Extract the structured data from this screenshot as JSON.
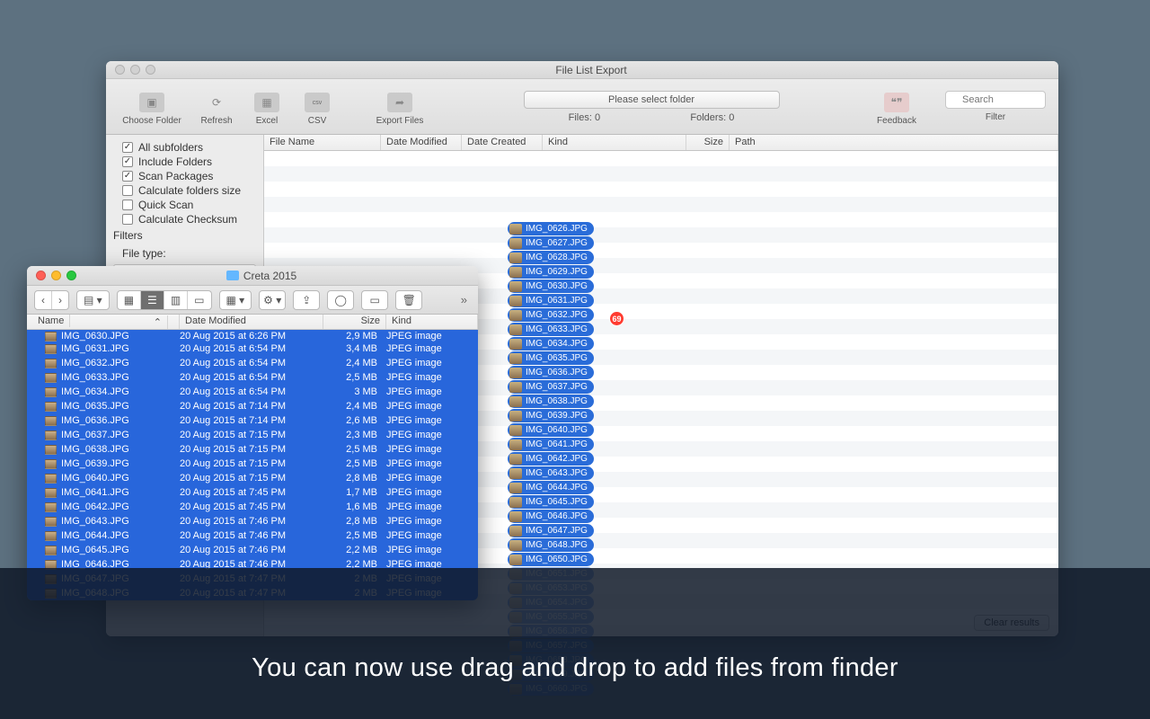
{
  "app": {
    "title": "File List Export",
    "toolbar": {
      "choose_folder": "Choose Folder",
      "refresh": "Refresh",
      "excel": "Excel",
      "csv": "CSV",
      "export_files": "Export Files",
      "feedback": "Feedback",
      "filter": "Filter",
      "search_placeholder": "Search"
    },
    "center": {
      "prompt": "Please select folder",
      "files_label": "Files: 0",
      "folders_label": "Folders: 0"
    },
    "sidebar": {
      "options": [
        {
          "label": "All subfolders",
          "checked": true
        },
        {
          "label": "Include Folders",
          "checked": true
        },
        {
          "label": "Scan Packages",
          "checked": true
        },
        {
          "label": "Calculate folders size",
          "checked": false
        },
        {
          "label": "Quick Scan",
          "checked": false
        },
        {
          "label": "Calculate Checksum",
          "checked": false
        }
      ],
      "filters_label": "Filters",
      "file_type_label": "File type:"
    },
    "columns": [
      "File Name",
      "Date Modified",
      "Date Created",
      "Kind",
      "Size",
      "Path"
    ],
    "clear_results": "Clear results",
    "drop_badge": "69",
    "drop_files": [
      "IMG_0626.JPG",
      "IMG_0627.JPG",
      "IMG_0628.JPG",
      "IMG_0629.JPG",
      "IMG_0630.JPG",
      "IMG_0631.JPG",
      "IMG_0632.JPG",
      "IMG_0633.JPG",
      "IMG_0634.JPG",
      "IMG_0635.JPG",
      "IMG_0636.JPG",
      "IMG_0637.JPG",
      "IMG_0638.JPG",
      "IMG_0639.JPG",
      "IMG_0640.JPG",
      "IMG_0641.JPG",
      "IMG_0642.JPG",
      "IMG_0643.JPG",
      "IMG_0644.JPG",
      "IMG_0645.JPG",
      "IMG_0646.JPG",
      "IMG_0647.JPG",
      "IMG_0648.JPG",
      "IMG_0650.JPG",
      "IMG_0651.JPG",
      "IMG_0653.JPG",
      "IMG_0654.JPG",
      "IMG_0655.JPG",
      "IMG_0656.JPG",
      "IMG_0657.JPG",
      "IMG_0658.JPG",
      "IMG_0659.JPG",
      "IMG_0660.JPG"
    ]
  },
  "finder": {
    "title": "Creta 2015",
    "columns": [
      "Name",
      "Date Modified",
      "Size",
      "Kind"
    ],
    "rows": [
      {
        "name": "IMG_0630.JPG",
        "date": "20 Aug 2015 at 6:26 PM",
        "size": "2,9 MB",
        "kind": "JPEG image"
      },
      {
        "name": "IMG_0631.JPG",
        "date": "20 Aug 2015 at 6:54 PM",
        "size": "3,4 MB",
        "kind": "JPEG image"
      },
      {
        "name": "IMG_0632.JPG",
        "date": "20 Aug 2015 at 6:54 PM",
        "size": "2,4 MB",
        "kind": "JPEG image"
      },
      {
        "name": "IMG_0633.JPG",
        "date": "20 Aug 2015 at 6:54 PM",
        "size": "2,5 MB",
        "kind": "JPEG image"
      },
      {
        "name": "IMG_0634.JPG",
        "date": "20 Aug 2015 at 6:54 PM",
        "size": "3 MB",
        "kind": "JPEG image"
      },
      {
        "name": "IMG_0635.JPG",
        "date": "20 Aug 2015 at 7:14 PM",
        "size": "2,4 MB",
        "kind": "JPEG image"
      },
      {
        "name": "IMG_0636.JPG",
        "date": "20 Aug 2015 at 7:14 PM",
        "size": "2,6 MB",
        "kind": "JPEG image"
      },
      {
        "name": "IMG_0637.JPG",
        "date": "20 Aug 2015 at 7:15 PM",
        "size": "2,3 MB",
        "kind": "JPEG image"
      },
      {
        "name": "IMG_0638.JPG",
        "date": "20 Aug 2015 at 7:15 PM",
        "size": "2,5 MB",
        "kind": "JPEG image"
      },
      {
        "name": "IMG_0639.JPG",
        "date": "20 Aug 2015 at 7:15 PM",
        "size": "2,5 MB",
        "kind": "JPEG image"
      },
      {
        "name": "IMG_0640.JPG",
        "date": "20 Aug 2015 at 7:15 PM",
        "size": "2,8 MB",
        "kind": "JPEG image"
      },
      {
        "name": "IMG_0641.JPG",
        "date": "20 Aug 2015 at 7:45 PM",
        "size": "1,7 MB",
        "kind": "JPEG image"
      },
      {
        "name": "IMG_0642.JPG",
        "date": "20 Aug 2015 at 7:45 PM",
        "size": "1,6 MB",
        "kind": "JPEG image"
      },
      {
        "name": "IMG_0643.JPG",
        "date": "20 Aug 2015 at 7:46 PM",
        "size": "2,8 MB",
        "kind": "JPEG image"
      },
      {
        "name": "IMG_0644.JPG",
        "date": "20 Aug 2015 at 7:46 PM",
        "size": "2,5 MB",
        "kind": "JPEG image"
      },
      {
        "name": "IMG_0645.JPG",
        "date": "20 Aug 2015 at 7:46 PM",
        "size": "2,2 MB",
        "kind": "JPEG image"
      },
      {
        "name": "IMG_0646.JPG",
        "date": "20 Aug 2015 at 7:46 PM",
        "size": "2,2 MB",
        "kind": "JPEG image"
      },
      {
        "name": "IMG_0647.JPG",
        "date": "20 Aug 2015 at 7:47 PM",
        "size": "2 MB",
        "kind": "JPEG image"
      },
      {
        "name": "IMG_0648.JPG",
        "date": "20 Aug 2015 at 7:47 PM",
        "size": "2 MB",
        "kind": "JPEG image"
      }
    ]
  },
  "footer": {
    "message": "You can now use drag and drop to add files from finder"
  }
}
